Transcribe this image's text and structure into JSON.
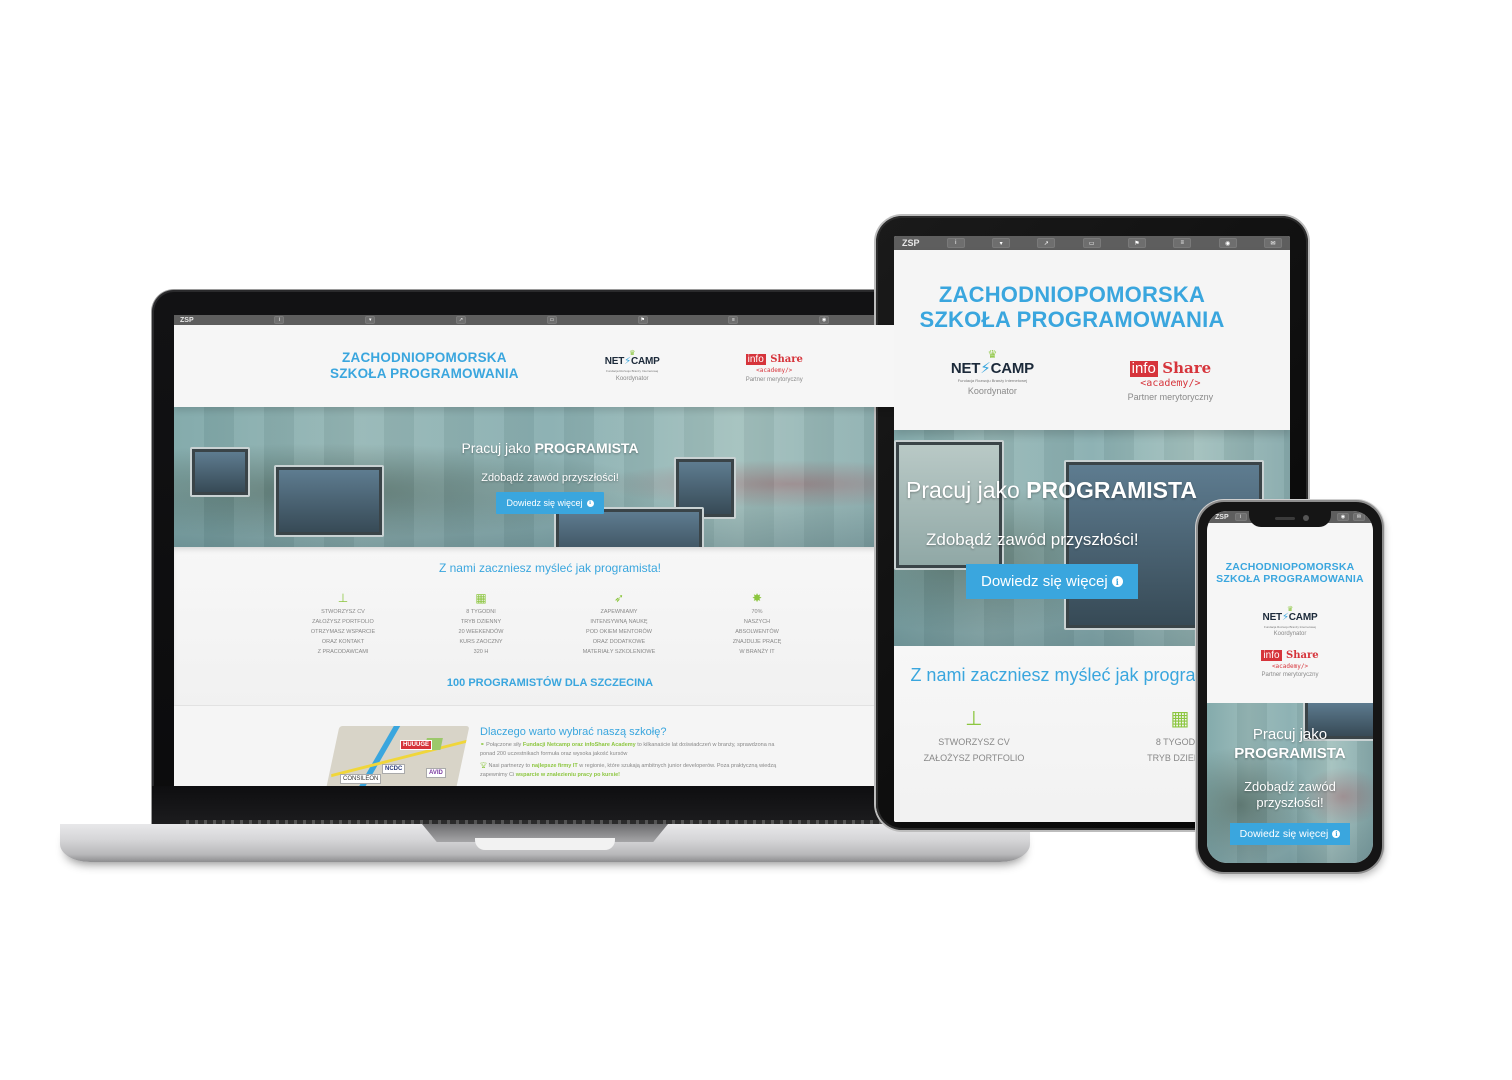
{
  "site": {
    "brand": "ZSP",
    "title_line1": "ZACHODNIOPOMORSKA",
    "title_line2": "SZKOŁA PROGRAMOWANIA",
    "nav_icons": [
      "info-icon",
      "shirt-icon",
      "chart-icon",
      "monitor-icon",
      "flag-icon",
      "list-icon",
      "eye-icon",
      "envelope-icon"
    ],
    "nav_glyphs": [
      "i",
      "▾",
      "↗",
      "▭",
      "⚑",
      "≡",
      "◉",
      "✉"
    ],
    "partners": {
      "netcamp": {
        "name_left": "NET",
        "name_right": "CAMP",
        "tagline": "Fundacja Rozwoju Branży Internetowej",
        "caption": "Koordynator"
      },
      "infoshare": {
        "info": "info",
        "share": "Share",
        "academy": "<academy/>",
        "caption": "Partner merytoryczny"
      }
    },
    "colors": {
      "accent_blue": "#3aa6de",
      "accent_green": "#8cc63f",
      "brand_red": "#d6343b",
      "topbar": "#5e5e5e"
    }
  },
  "hero": {
    "line1_prefix": "Pracuj jako ",
    "line1_strong": "PROGRAMISTA",
    "subtitle": "Zdobądź zawód przyszłości!",
    "cta_label": "Dowiedz się więcej",
    "cta_icon": "info-circle-icon"
  },
  "features": {
    "title": "Z nami zaczniesz myśleć jak programista!",
    "items": [
      {
        "icon": "sitemap-icon",
        "glyph": "⊥",
        "lines": [
          "STWORZYSZ CV",
          "ZAŁOŻYSZ PORTFOLIO",
          "OTRZYMASZ WSPARCIE",
          "ORAZ KONTAKT",
          "Z PRACODAWCAMI"
        ]
      },
      {
        "icon": "calendar-icon",
        "glyph": "▦",
        "lines": [
          "8 TYGODNI",
          "TRYB DZIENNY",
          "20 WEEKENDÓW",
          "KURS ZAOCZNY",
          "320 H"
        ]
      },
      {
        "icon": "rocket-icon",
        "glyph": "➶",
        "lines": [
          "ZAPEWNIAMY",
          "INTENSYWNĄ NAUKĘ",
          "POD OKIEM MENTORÓW",
          "ORAZ DODATKOWE",
          "MATERIAŁY SZKOLENIOWE"
        ]
      },
      {
        "icon": "badge-icon",
        "glyph": "✸",
        "lines": [
          "70%",
          "NASZYCH",
          "ABSOLWENTÓW",
          "ZNAJDUJE PRACĘ",
          "W BRANŻY IT"
        ]
      }
    ],
    "headline": "100 PROGRAMISTÓW DLA SZCZECINA"
  },
  "why": {
    "title": "Dlaczego warto wybrać naszą szkołę?",
    "p1_before": "Połączone siły ",
    "p1_strong": "Fundacji Netcamp oraz infoShare Academy",
    "p1_after": " to kilkanaście lat doświadczeń w branży, sprawdzona na ponad 200 uczestnikach formuła oraz wysoka jakość kursów",
    "p2_before": "Nasi partnerzy to ",
    "p2_strong": "najlepsze firmy IT",
    "p2_after": " w regionie, które szukają ambitnych junior developerów.",
    "p3_before": "Poza praktyczną wiedzą zapewnimy Ci ",
    "p3_strong": "wsparcie w znalezieniu pracy po kursie!",
    "map_pins": [
      "HUUUGE",
      "NCDC",
      "AVID",
      "CONSILEON"
    ]
  }
}
